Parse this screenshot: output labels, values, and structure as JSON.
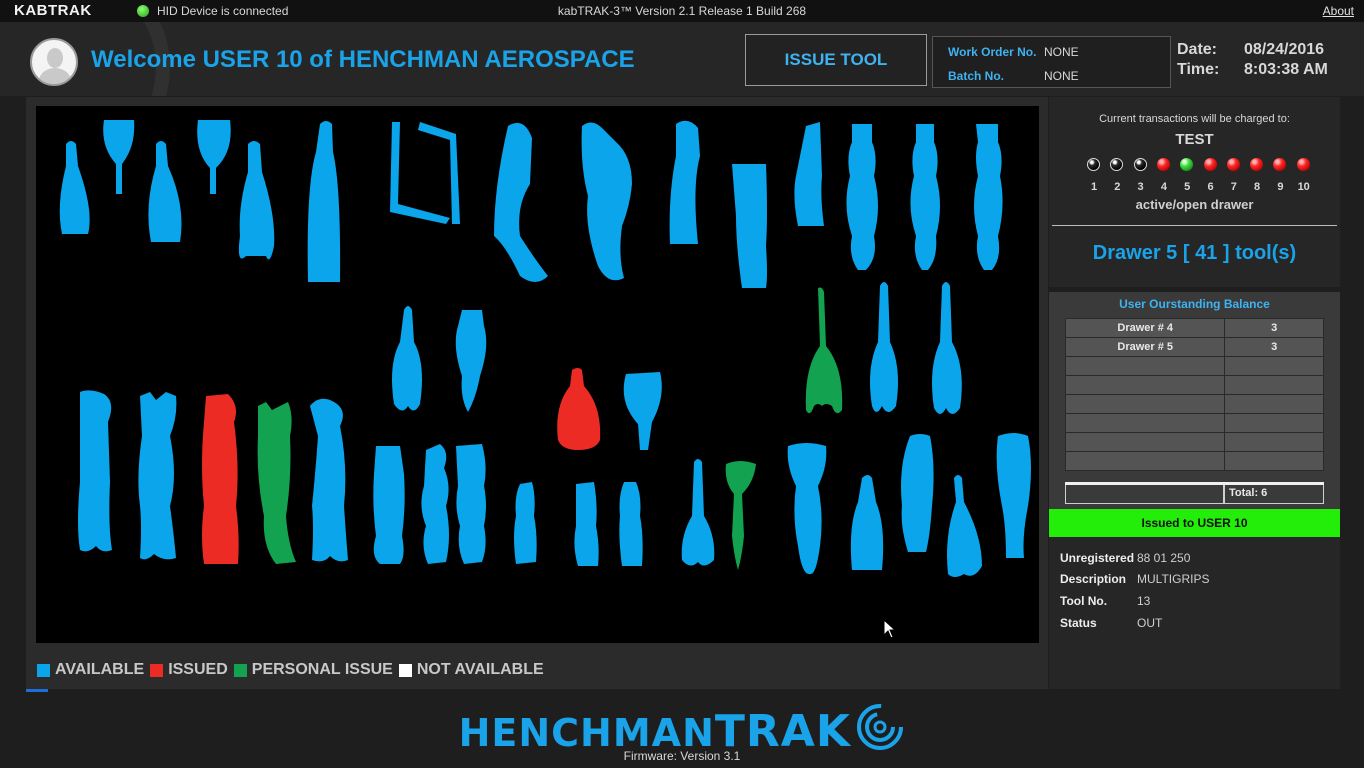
{
  "titlebar": {
    "logo": "KABTRAK",
    "hid_status": "HID Device is connected",
    "window_title": "kabTRAK-3™ Version 2.1 Release 1 Build 268",
    "about": "About"
  },
  "header": {
    "welcome": "Welcome USER 10 of HENCHMAN AEROSPACE",
    "issue_button": "ISSUE TOOL",
    "work_order_label": "Work Order No.",
    "work_order_value": "NONE",
    "batch_label": "Batch No.",
    "batch_value": "NONE",
    "date_label": "Date:",
    "date_value": "08/24/2016",
    "time_label": "Time:",
    "time_value": "8:03:38 AM"
  },
  "legend": {
    "available": "AVAILABLE",
    "issued": "ISSUED",
    "personal_issue": "PERSONAL ISSUE",
    "not_available": "NOT AVAILABLE"
  },
  "colors": {
    "available": "#0aa5ea",
    "issued": "#ec2b25",
    "personal_issue": "#13a24f",
    "not_available": "#ffffff",
    "accent": "#1aa3e8",
    "issued_banner": "#22ee0a"
  },
  "right_panel": {
    "charged_to_label": "Current  transactions will be charged to:",
    "account": "TEST",
    "active_drawer_label": "active/open drawer",
    "drawer_lamps": [
      {
        "num": "1",
        "state": "black"
      },
      {
        "num": "2",
        "state": "black"
      },
      {
        "num": "3",
        "state": "black"
      },
      {
        "num": "4",
        "state": "red"
      },
      {
        "num": "5",
        "state": "green"
      },
      {
        "num": "6",
        "state": "red"
      },
      {
        "num": "7",
        "state": "red"
      },
      {
        "num": "8",
        "state": "red"
      },
      {
        "num": "9",
        "state": "red"
      },
      {
        "num": "10",
        "state": "red"
      }
    ],
    "drawer_summary": "Drawer 5 [ 41 ] tool(s)",
    "balance_title": "User Ourstanding Balance",
    "balance_rows": [
      {
        "drawer": "Drawer # 4",
        "count": "3"
      },
      {
        "drawer": "Drawer # 5",
        "count": "3"
      },
      {
        "drawer": "",
        "count": ""
      },
      {
        "drawer": "",
        "count": ""
      },
      {
        "drawer": "",
        "count": ""
      },
      {
        "drawer": "",
        "count": ""
      },
      {
        "drawer": "",
        "count": ""
      },
      {
        "drawer": "",
        "count": ""
      }
    ],
    "total": "Total:  6",
    "issued_to": "Issued to USER 10",
    "details": {
      "unregistered_label": "Unregistered",
      "unregistered_value": "88 01 250",
      "description_label": "Description",
      "description_value": "MULTIGRIPS",
      "tool_no_label": "Tool No.",
      "tool_no_value": "13",
      "status_label": "Status",
      "status_value": "OUT"
    }
  },
  "footer": {
    "brand_left": "HENCHMAN",
    "brand_right": "TRAK",
    "firmware": "Firmware: Version 3.1"
  }
}
